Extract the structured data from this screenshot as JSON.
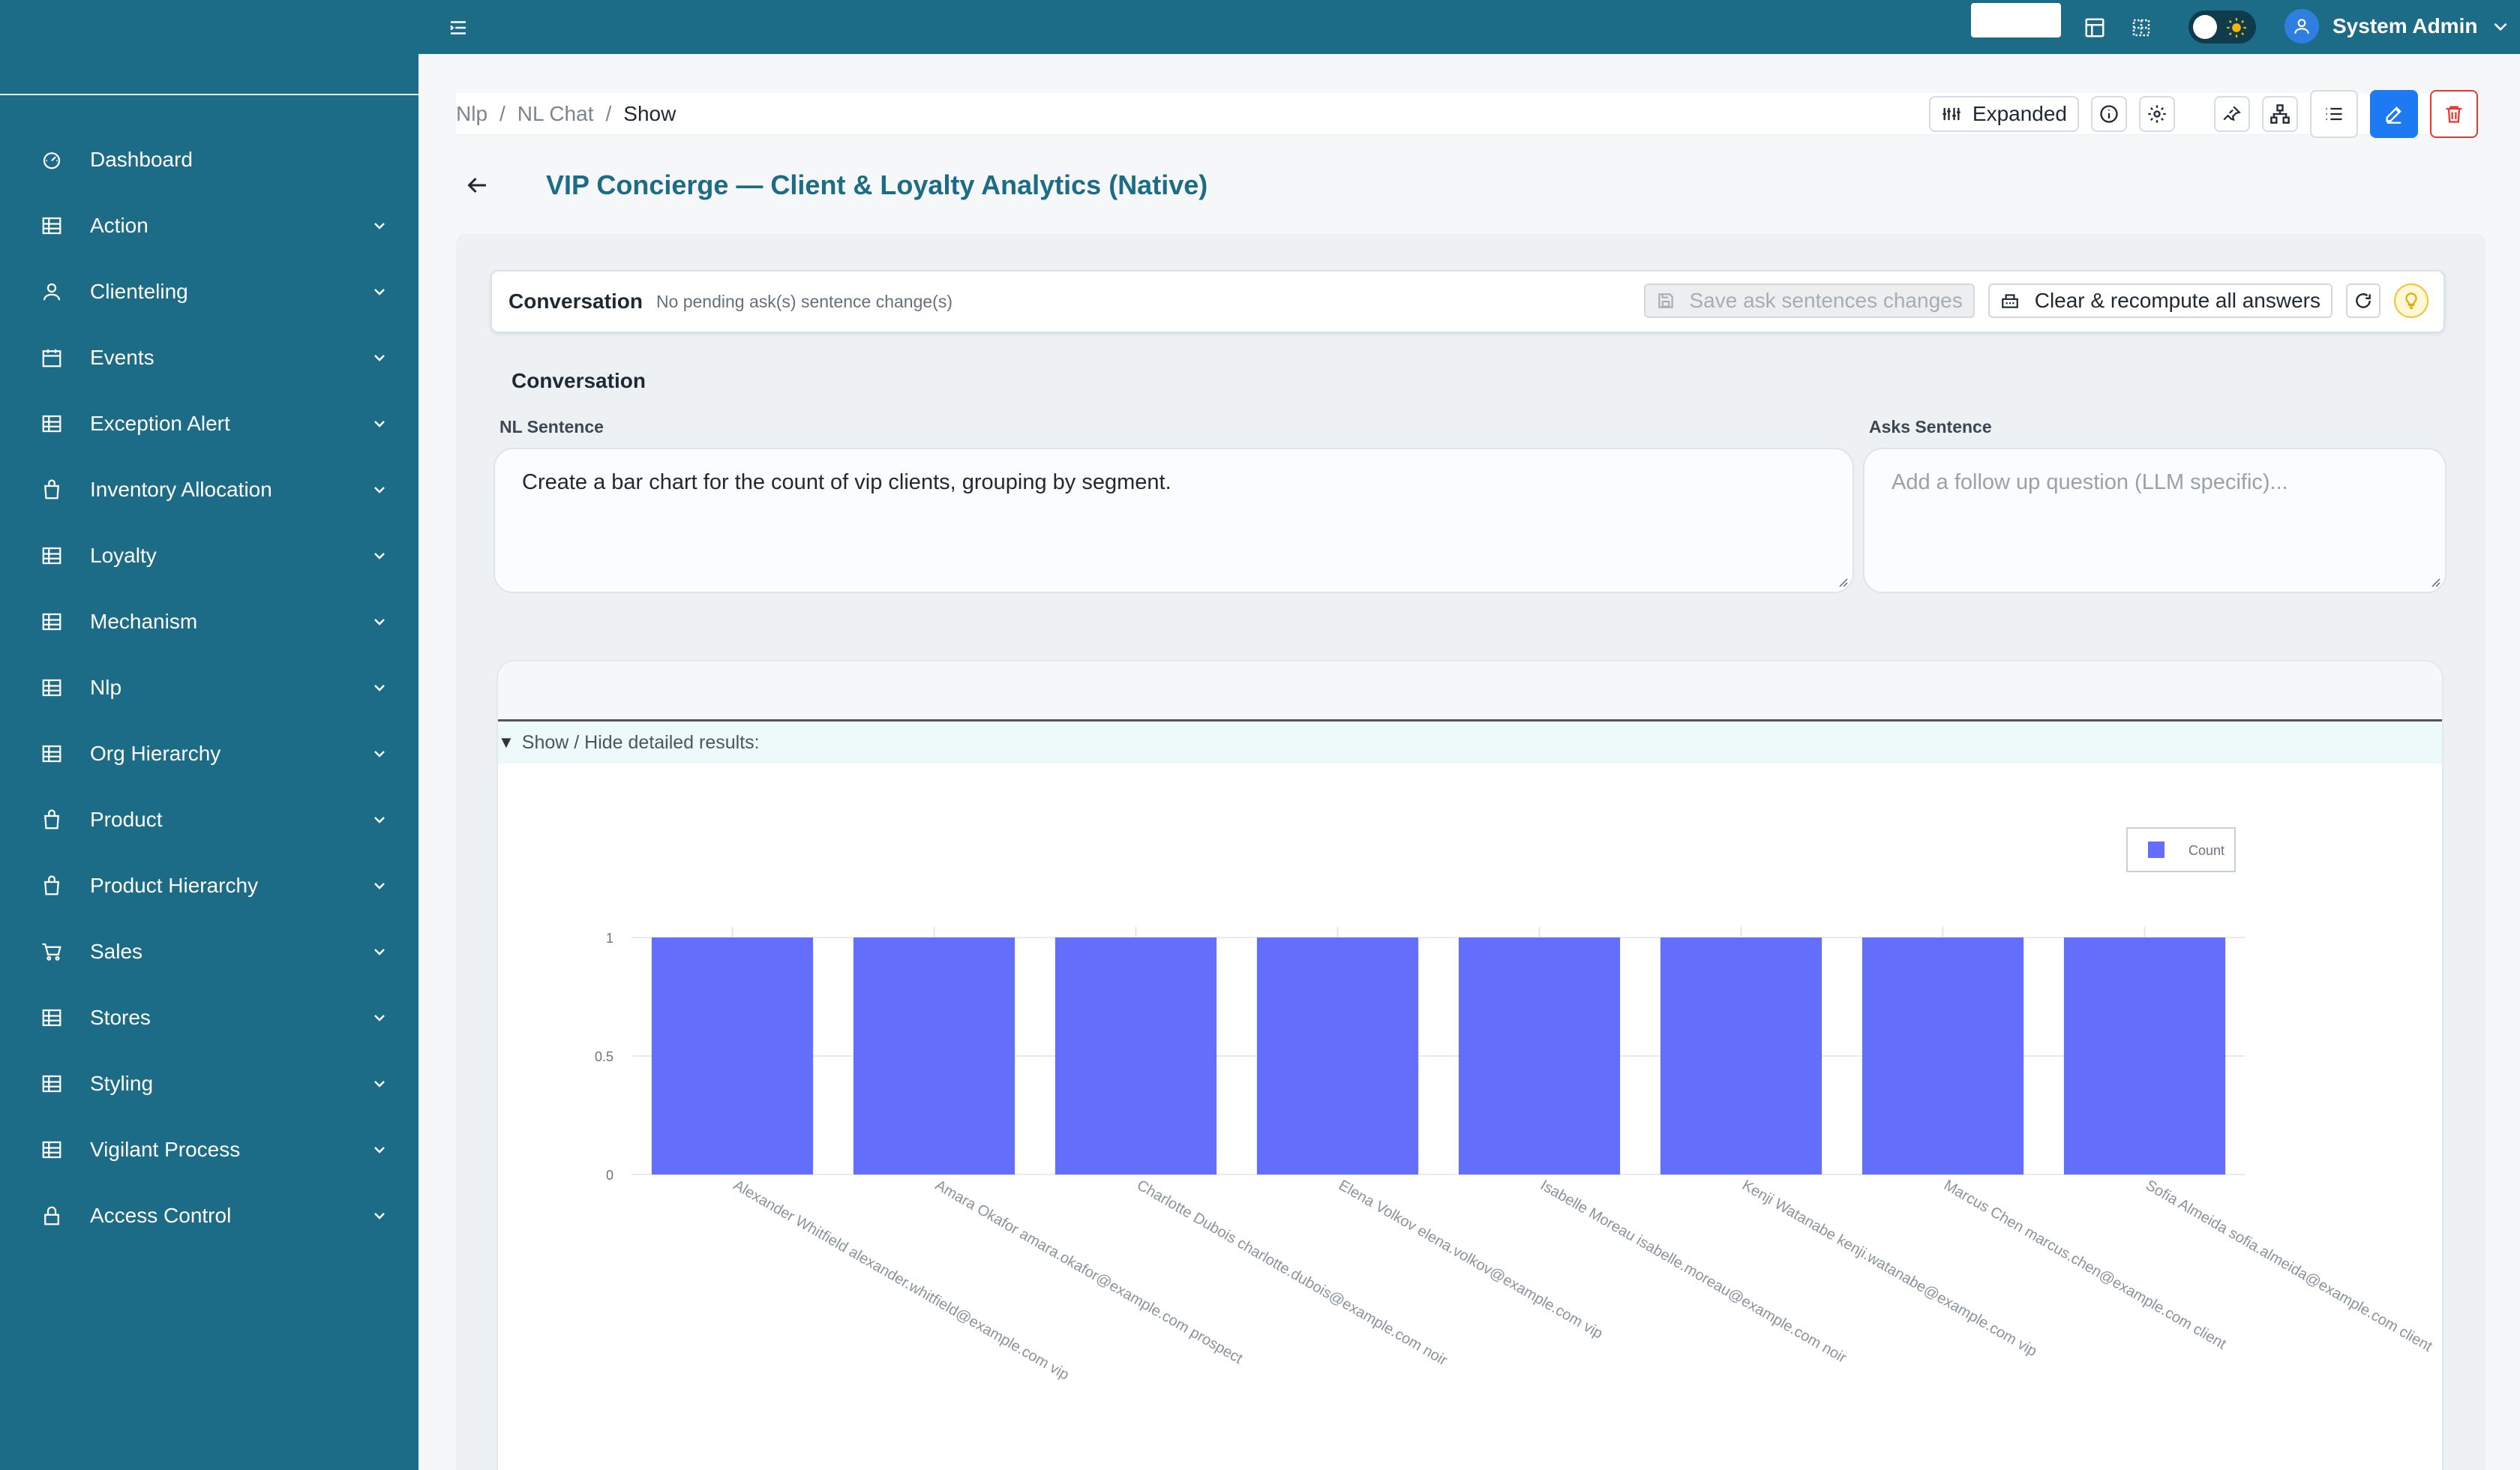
{
  "sidebar": {
    "items": [
      {
        "label": "Dashboard",
        "icon": "dashboard-icon"
      },
      {
        "label": "Action",
        "icon": "grid-icon"
      },
      {
        "label": "Clienteling",
        "icon": "user-icon"
      },
      {
        "label": "Events",
        "icon": "calendar-icon"
      },
      {
        "label": "Exception Alert",
        "icon": "grid-icon"
      },
      {
        "label": "Inventory Allocation",
        "icon": "bag-icon"
      },
      {
        "label": "Loyalty",
        "icon": "grid-icon"
      },
      {
        "label": "Mechanism",
        "icon": "grid-icon"
      },
      {
        "label": "Nlp",
        "icon": "grid-icon"
      },
      {
        "label": "Org Hierarchy",
        "icon": "grid-icon"
      },
      {
        "label": "Product",
        "icon": "bag-icon"
      },
      {
        "label": "Product Hierarchy",
        "icon": "bag-icon"
      },
      {
        "label": "Sales",
        "icon": "cart-icon"
      },
      {
        "label": "Stores",
        "icon": "grid-icon"
      },
      {
        "label": "Styling",
        "icon": "grid-icon"
      },
      {
        "label": "Vigilant Process",
        "icon": "grid-icon"
      },
      {
        "label": "Access Control",
        "icon": "lock-icon"
      }
    ]
  },
  "topbar": {
    "user_name": "System Admin"
  },
  "breadcrumb": {
    "items": [
      "Nlp",
      "NL Chat"
    ],
    "current": "Show"
  },
  "toolbar": {
    "expanded_label": "Expanded"
  },
  "page": {
    "title": "VIP Concierge — Client & Loyalty Analytics (Native)"
  },
  "conversation_bar": {
    "title": "Conversation",
    "status": "No pending ask(s) sentence change(s)",
    "save_label": "Save ask sentences changes",
    "clear_label": "Clear & recompute all answers"
  },
  "conversation": {
    "section_title": "Conversation",
    "nl_label": "NL Sentence",
    "nl_value": "Create a bar chart for the count of vip clients, grouping by segment.",
    "asks_label": "Asks Sentence",
    "asks_placeholder": "Add a follow up question (LLM specific)..."
  },
  "results": {
    "toggle_label": "Show / Hide detailed results:"
  },
  "colors": {
    "sidebar_bg": "#1c6b87",
    "title_color": "#1c6b87",
    "bar_color": "#636efa",
    "edit_button": "#1d7af3",
    "delete_button": "#e53935"
  },
  "chart_data": {
    "type": "bar",
    "categories": [
      "Alexander Whitfield alexander.whitfield@example.com vip",
      "Amara Okafor amara.okafor@example.com prospect",
      "Charlotte Dubois charlotte.dubois@example.com noir",
      "Elena Volkov elena.volkov@example.com vip",
      "Isabelle Moreau isabelle.moreau@example.com noir",
      "Kenji Watanabe kenji.watanabe@example.com vip",
      "Marcus Chen marcus.chen@example.com client",
      "Sofia Almeida sofia.almeida@example.com client"
    ],
    "series": [
      {
        "name": "Count",
        "values": [
          1,
          1,
          1,
          1,
          1,
          1,
          1,
          1
        ]
      }
    ],
    "ylim": [
      0,
      1
    ],
    "yticks": [
      "0",
      "0.5",
      "1"
    ],
    "grid": true,
    "legend": "top-right"
  }
}
